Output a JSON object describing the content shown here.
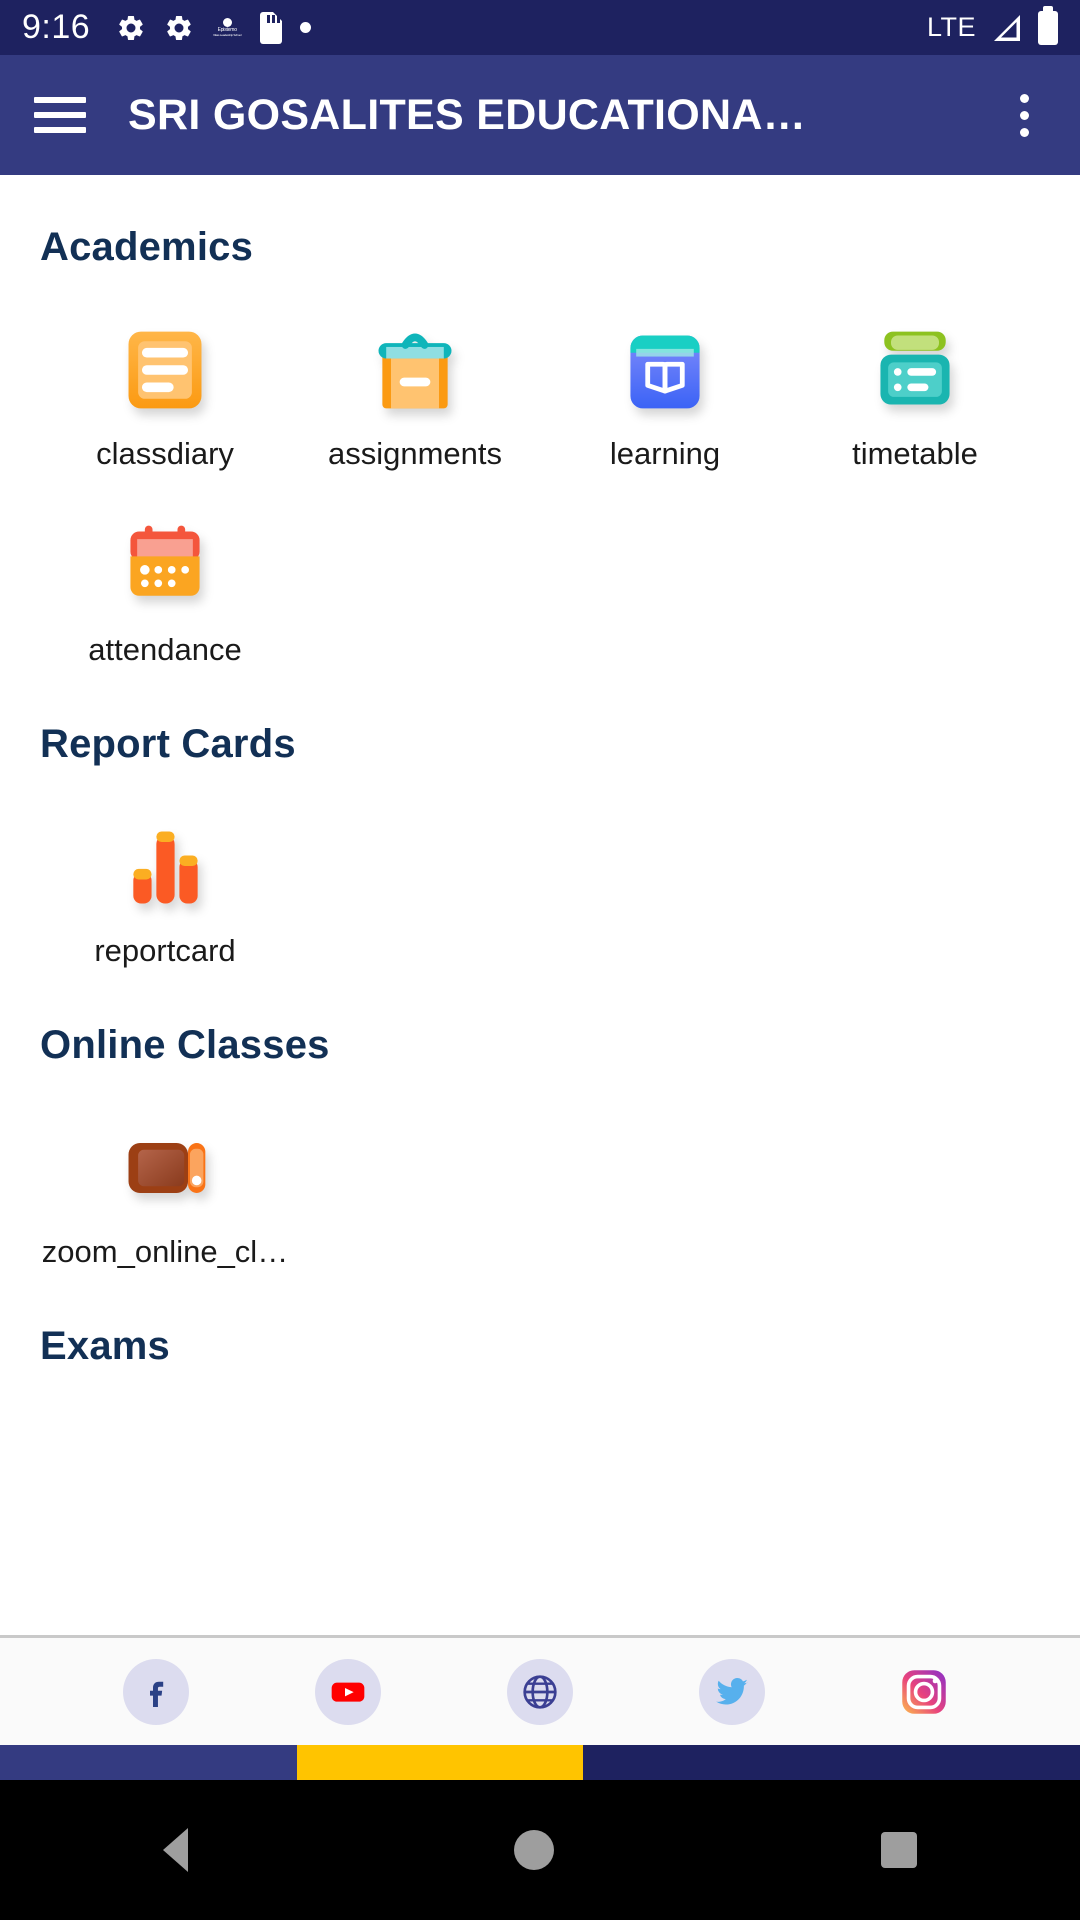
{
  "statusbar": {
    "time": "9:16",
    "network": "LTE",
    "icons": [
      "gear-icon",
      "gear-icon",
      "app-logo-icon",
      "sd-card-icon",
      "dot-icon"
    ],
    "logo_line1": "Epistemo",
    "logo_line2": "Vikas Leadership School",
    "right_icons": [
      "signal-icon",
      "battery-icon"
    ]
  },
  "appbar": {
    "title": "SRI GOSALITES EDUCATIONA…",
    "menu_label": "menu-icon",
    "overflow_label": "more-options-icon",
    "background": "#343b81"
  },
  "sections": [
    {
      "title": "Academics",
      "tiles": [
        {
          "label": "classdiary",
          "icon": "class-diary-icon"
        },
        {
          "label": "assignments",
          "icon": "assignments-clipboard-icon"
        },
        {
          "label": "learning",
          "icon": "learning-book-icon"
        },
        {
          "label": "timetable",
          "icon": "timetable-icon"
        },
        {
          "label": "attendance",
          "icon": "attendance-calendar-icon"
        }
      ]
    },
    {
      "title": "Report Cards",
      "tiles": [
        {
          "label": "reportcard",
          "icon": "report-card-bars-icon"
        }
      ]
    },
    {
      "title": "Online Classes",
      "tiles": [
        {
          "label": "zoom_online_cl…",
          "icon": "zoom-online-class-icon"
        }
      ]
    },
    {
      "title": "Exams",
      "tiles": []
    }
  ],
  "social": [
    {
      "name": "facebook-icon",
      "label": "Facebook"
    },
    {
      "name": "youtube-icon",
      "label": "YouTube"
    },
    {
      "name": "website-globe-icon",
      "label": "Website"
    },
    {
      "name": "twitter-icon",
      "label": "Twitter"
    },
    {
      "name": "instagram-icon",
      "label": "Instagram"
    }
  ],
  "colors": {
    "statusbar": "#1e2260",
    "appbar": "#343b81",
    "section_heading": "#123055",
    "accent_yellow": "#ffc400"
  },
  "navbar": {
    "back": "back-nav-button",
    "home": "home-nav-button",
    "recent": "recent-apps-nav-button"
  }
}
